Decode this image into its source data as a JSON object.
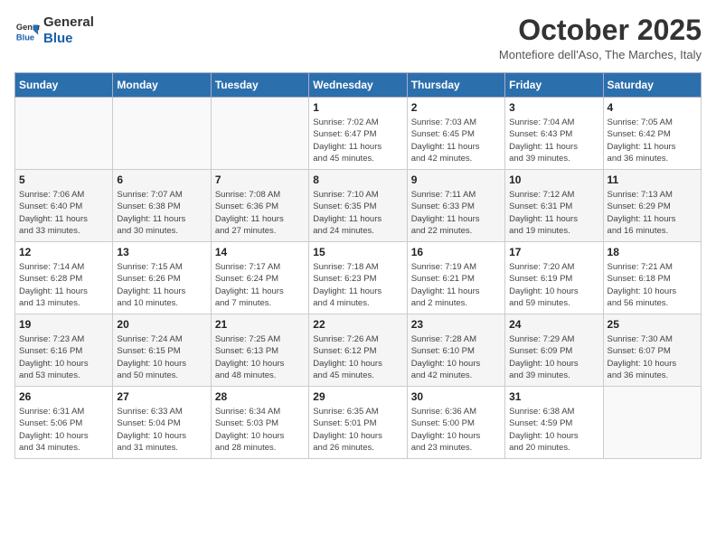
{
  "header": {
    "logo_line1": "General",
    "logo_line2": "Blue",
    "month": "October 2025",
    "location": "Montefiore dell'Aso, The Marches, Italy"
  },
  "days_of_week": [
    "Sunday",
    "Monday",
    "Tuesday",
    "Wednesday",
    "Thursday",
    "Friday",
    "Saturday"
  ],
  "weeks": [
    [
      {
        "day": "",
        "detail": ""
      },
      {
        "day": "",
        "detail": ""
      },
      {
        "day": "",
        "detail": ""
      },
      {
        "day": "1",
        "detail": "Sunrise: 7:02 AM\nSunset: 6:47 PM\nDaylight: 11 hours\nand 45 minutes."
      },
      {
        "day": "2",
        "detail": "Sunrise: 7:03 AM\nSunset: 6:45 PM\nDaylight: 11 hours\nand 42 minutes."
      },
      {
        "day": "3",
        "detail": "Sunrise: 7:04 AM\nSunset: 6:43 PM\nDaylight: 11 hours\nand 39 minutes."
      },
      {
        "day": "4",
        "detail": "Sunrise: 7:05 AM\nSunset: 6:42 PM\nDaylight: 11 hours\nand 36 minutes."
      }
    ],
    [
      {
        "day": "5",
        "detail": "Sunrise: 7:06 AM\nSunset: 6:40 PM\nDaylight: 11 hours\nand 33 minutes."
      },
      {
        "day": "6",
        "detail": "Sunrise: 7:07 AM\nSunset: 6:38 PM\nDaylight: 11 hours\nand 30 minutes."
      },
      {
        "day": "7",
        "detail": "Sunrise: 7:08 AM\nSunset: 6:36 PM\nDaylight: 11 hours\nand 27 minutes."
      },
      {
        "day": "8",
        "detail": "Sunrise: 7:10 AM\nSunset: 6:35 PM\nDaylight: 11 hours\nand 24 minutes."
      },
      {
        "day": "9",
        "detail": "Sunrise: 7:11 AM\nSunset: 6:33 PM\nDaylight: 11 hours\nand 22 minutes."
      },
      {
        "day": "10",
        "detail": "Sunrise: 7:12 AM\nSunset: 6:31 PM\nDaylight: 11 hours\nand 19 minutes."
      },
      {
        "day": "11",
        "detail": "Sunrise: 7:13 AM\nSunset: 6:29 PM\nDaylight: 11 hours\nand 16 minutes."
      }
    ],
    [
      {
        "day": "12",
        "detail": "Sunrise: 7:14 AM\nSunset: 6:28 PM\nDaylight: 11 hours\nand 13 minutes."
      },
      {
        "day": "13",
        "detail": "Sunrise: 7:15 AM\nSunset: 6:26 PM\nDaylight: 11 hours\nand 10 minutes."
      },
      {
        "day": "14",
        "detail": "Sunrise: 7:17 AM\nSunset: 6:24 PM\nDaylight: 11 hours\nand 7 minutes."
      },
      {
        "day": "15",
        "detail": "Sunrise: 7:18 AM\nSunset: 6:23 PM\nDaylight: 11 hours\nand 4 minutes."
      },
      {
        "day": "16",
        "detail": "Sunrise: 7:19 AM\nSunset: 6:21 PM\nDaylight: 11 hours\nand 2 minutes."
      },
      {
        "day": "17",
        "detail": "Sunrise: 7:20 AM\nSunset: 6:19 PM\nDaylight: 10 hours\nand 59 minutes."
      },
      {
        "day": "18",
        "detail": "Sunrise: 7:21 AM\nSunset: 6:18 PM\nDaylight: 10 hours\nand 56 minutes."
      }
    ],
    [
      {
        "day": "19",
        "detail": "Sunrise: 7:23 AM\nSunset: 6:16 PM\nDaylight: 10 hours\nand 53 minutes."
      },
      {
        "day": "20",
        "detail": "Sunrise: 7:24 AM\nSunset: 6:15 PM\nDaylight: 10 hours\nand 50 minutes."
      },
      {
        "day": "21",
        "detail": "Sunrise: 7:25 AM\nSunset: 6:13 PM\nDaylight: 10 hours\nand 48 minutes."
      },
      {
        "day": "22",
        "detail": "Sunrise: 7:26 AM\nSunset: 6:12 PM\nDaylight: 10 hours\nand 45 minutes."
      },
      {
        "day": "23",
        "detail": "Sunrise: 7:28 AM\nSunset: 6:10 PM\nDaylight: 10 hours\nand 42 minutes."
      },
      {
        "day": "24",
        "detail": "Sunrise: 7:29 AM\nSunset: 6:09 PM\nDaylight: 10 hours\nand 39 minutes."
      },
      {
        "day": "25",
        "detail": "Sunrise: 7:30 AM\nSunset: 6:07 PM\nDaylight: 10 hours\nand 36 minutes."
      }
    ],
    [
      {
        "day": "26",
        "detail": "Sunrise: 6:31 AM\nSunset: 5:06 PM\nDaylight: 10 hours\nand 34 minutes."
      },
      {
        "day": "27",
        "detail": "Sunrise: 6:33 AM\nSunset: 5:04 PM\nDaylight: 10 hours\nand 31 minutes."
      },
      {
        "day": "28",
        "detail": "Sunrise: 6:34 AM\nSunset: 5:03 PM\nDaylight: 10 hours\nand 28 minutes."
      },
      {
        "day": "29",
        "detail": "Sunrise: 6:35 AM\nSunset: 5:01 PM\nDaylight: 10 hours\nand 26 minutes."
      },
      {
        "day": "30",
        "detail": "Sunrise: 6:36 AM\nSunset: 5:00 PM\nDaylight: 10 hours\nand 23 minutes."
      },
      {
        "day": "31",
        "detail": "Sunrise: 6:38 AM\nSunset: 4:59 PM\nDaylight: 10 hours\nand 20 minutes."
      },
      {
        "day": "",
        "detail": ""
      }
    ]
  ]
}
